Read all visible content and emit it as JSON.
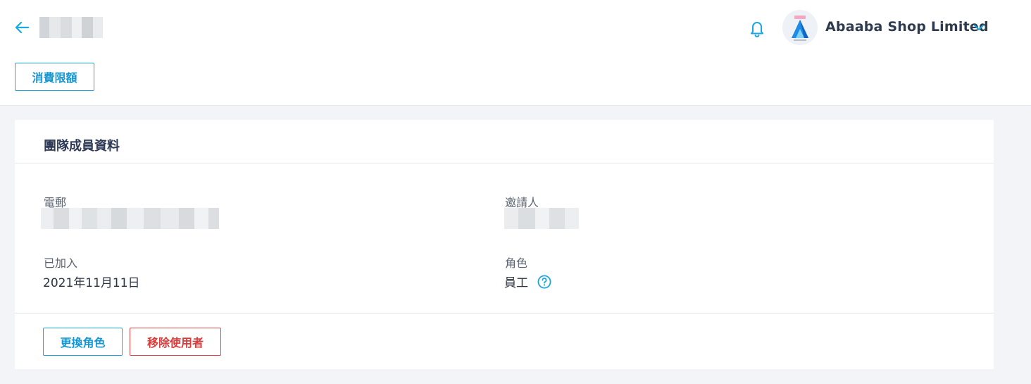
{
  "header": {
    "back_icon": "arrow-left-icon",
    "notification_icon": "bell-icon",
    "account_name": "Abaaba Shop Limited",
    "account_menu_icon": "chevron-down-icon",
    "accent_color": "#1ba7e0"
  },
  "toolbar": {
    "spending_limit_label": "消費限額"
  },
  "card": {
    "title": "團隊成員資料",
    "fields": {
      "email_label": "電郵",
      "inviter_label": "邀請人",
      "joined_label": "已加入",
      "joined_value": "2021年11月11日",
      "role_label": "角色",
      "role_value": "員工",
      "role_help_icon": "question-circle-icon"
    },
    "actions": {
      "change_role_label": "更換角色",
      "remove_user_label": "移除使用者",
      "danger_color": "#e04848"
    }
  }
}
